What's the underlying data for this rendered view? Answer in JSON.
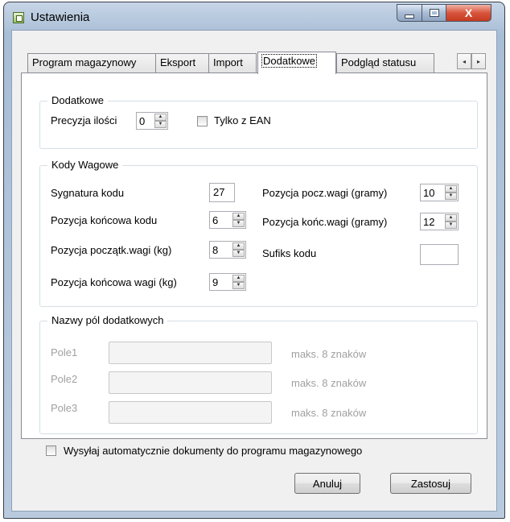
{
  "window": {
    "title": "Ustawienia",
    "close_glyph": "X"
  },
  "tabs": [
    {
      "label": "Program magazynowy"
    },
    {
      "label": "Eksport"
    },
    {
      "label": "Import"
    },
    {
      "label": "Dodatkowe"
    },
    {
      "label": "Podgląd statusu"
    }
  ],
  "tab_scroll": {
    "left": "◂",
    "right": "▸"
  },
  "dodatkowe": {
    "title": "Dodatkowe",
    "precyzja_label": "Precyzja ilości",
    "precyzja_value": "0",
    "tylko_ean_label": "Tylko z EAN",
    "tylko_ean_checked": false
  },
  "kody_wagowe": {
    "title": "Kody Wagowe",
    "sygnatura_label": "Sygnatura kodu",
    "sygnatura_value": "27",
    "poz_konc_kodu_label": "Pozycja końcowa kodu",
    "poz_konc_kodu_value": "6",
    "poz_pocz_wagi_kg_label": "Pozycja początk.wagi (kg)",
    "poz_pocz_wagi_kg_value": "8",
    "poz_konc_wagi_kg_label": "Pozycja końcowa wagi (kg)",
    "poz_konc_wagi_kg_value": "9",
    "poz_pocz_wagi_g_label": "Pozycja pocz.wagi (gramy)",
    "poz_pocz_wagi_g_value": "10",
    "poz_konc_wagi_g_label": "Pozycja końc.wagi (gramy)",
    "poz_konc_wagi_g_value": "12",
    "sufiks_label": "Sufiks kodu",
    "sufiks_value": ""
  },
  "nazwy_pol": {
    "title": "Nazwy pól dodatkowych",
    "fields": [
      {
        "label": "Pole1",
        "value": "",
        "hint": "maks. 8 znaków"
      },
      {
        "label": "Pole2",
        "value": "",
        "hint": "maks. 8 znaków"
      },
      {
        "label": "Pole3",
        "value": "",
        "hint": "maks. 8 znaków"
      }
    ]
  },
  "auto_send": {
    "label": "Wysyłaj automatycznie dokumenty do programu magazynowego",
    "checked": false
  },
  "buttons": {
    "cancel": "Anuluj",
    "apply": "Zastosuj"
  },
  "spin": {
    "up": "▲",
    "down": "▼"
  }
}
